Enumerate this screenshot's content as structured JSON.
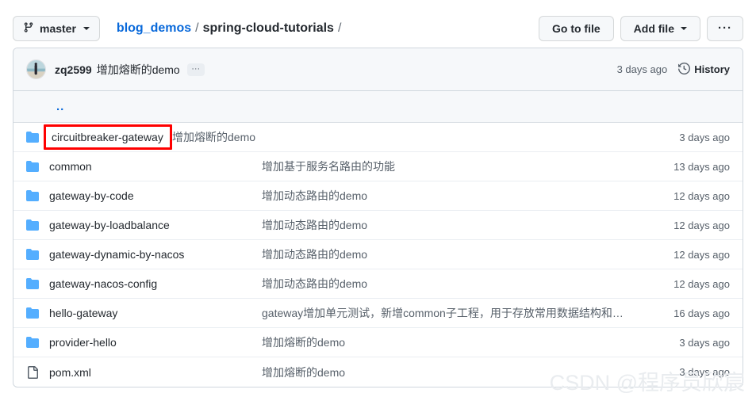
{
  "toolbar": {
    "branch": {
      "icon": "git-branch-icon",
      "label": "master"
    },
    "breadcrumb": {
      "owner": "blog_demos",
      "sep": "/",
      "current": "spring-cloud-tutorials",
      "trailing": "/"
    },
    "go_to_file": "Go to file",
    "add_file": "Add file",
    "kebab": "···"
  },
  "commit_bar": {
    "avatar": "user-avatar",
    "author": "zq2599",
    "message": "增加熔断的demo",
    "expand": "···",
    "time": "3 days ago",
    "history_icon": "history-clock-icon",
    "history": "History"
  },
  "parent_row": {
    "label": ".."
  },
  "files": [
    {
      "icon": "folder-icon",
      "type": "folder",
      "name": "circuitbreaker-gateway",
      "message": "增加熔断的demo",
      "time": "3 days ago",
      "highlighted": true
    },
    {
      "icon": "folder-icon",
      "type": "folder",
      "name": "common",
      "message": "增加基于服务名路由的功能",
      "time": "13 days ago",
      "highlighted": false
    },
    {
      "icon": "folder-icon",
      "type": "folder",
      "name": "gateway-by-code",
      "message": "增加动态路由的demo",
      "time": "12 days ago",
      "highlighted": false
    },
    {
      "icon": "folder-icon",
      "type": "folder",
      "name": "gateway-by-loadbalance",
      "message": "增加动态路由的demo",
      "time": "12 days ago",
      "highlighted": false
    },
    {
      "icon": "folder-icon",
      "type": "folder",
      "name": "gateway-dynamic-by-nacos",
      "message": "增加动态路由的demo",
      "time": "12 days ago",
      "highlighted": false
    },
    {
      "icon": "folder-icon",
      "type": "folder",
      "name": "gateway-nacos-config",
      "message": "增加动态路由的demo",
      "time": "12 days ago",
      "highlighted": false
    },
    {
      "icon": "folder-icon",
      "type": "folder",
      "name": "hello-gateway",
      "message": "gateway增加单元测试，新增common子工程，用于存放常用数据结构和常量",
      "time": "16 days ago",
      "highlighted": false
    },
    {
      "icon": "folder-icon",
      "type": "folder",
      "name": "provider-hello",
      "message": "增加熔断的demo",
      "time": "3 days ago",
      "highlighted": false
    },
    {
      "icon": "file-icon",
      "type": "file",
      "name": "pom.xml",
      "message": "增加熔断的demo",
      "time": "3 days ago",
      "highlighted": false
    }
  ],
  "watermark": {
    "text": "CSDN @程序员欣宸"
  },
  "colors": {
    "link": "#0969da",
    "folder": "#54aeff",
    "highlight_box": "#ff0000",
    "border": "#d0d7de",
    "muted_text": "#57606a",
    "row_bg": "#f6f8fa"
  }
}
